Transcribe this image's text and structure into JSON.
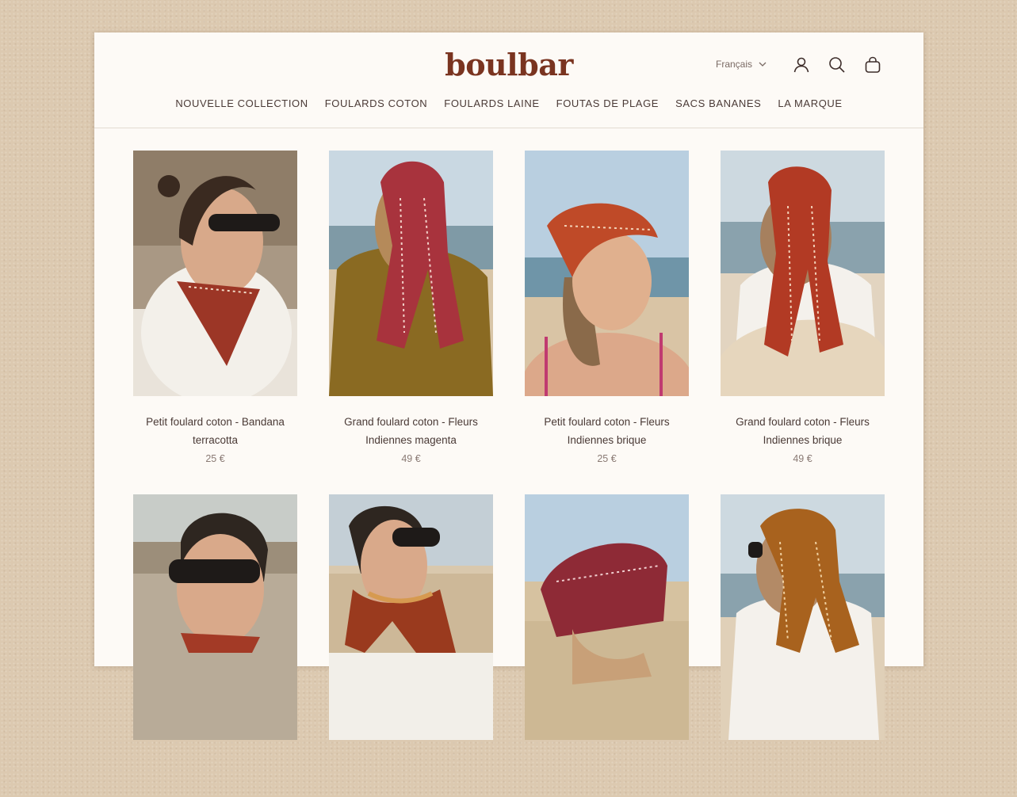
{
  "brand": {
    "logo_text": "boulbar",
    "accent_color": "#7a3420"
  },
  "header": {
    "language": "Français",
    "icons": [
      "account-icon",
      "search-icon",
      "bag-icon"
    ]
  },
  "nav": {
    "items": [
      {
        "label": "NOUVELLE COLLECTION"
      },
      {
        "label": "FOULARDS COTON"
      },
      {
        "label": "FOULARDS LAINE"
      },
      {
        "label": "FOUTAS DE PLAGE"
      },
      {
        "label": "SACS BANANES"
      },
      {
        "label": "LA MARQUE"
      }
    ]
  },
  "products": [
    {
      "title": "Petit foulard coton - Bandana terracotta",
      "price": "25 €",
      "scarf_color": "#9c3626"
    },
    {
      "title": "Grand foulard coton - Fleurs Indiennes magenta",
      "price": "49 €",
      "scarf_color": "#a8333d"
    },
    {
      "title": "Petit foulard coton - Fleurs Indiennes brique",
      "price": "25 €",
      "scarf_color": "#bf4a28"
    },
    {
      "title": "Grand foulard coton - Fleurs Indiennes brique",
      "price": "49 €",
      "scarf_color": "#b23a24"
    },
    {
      "title": "",
      "price": "",
      "scarf_color": "#a33a26"
    },
    {
      "title": "",
      "price": "",
      "scarf_color": "#9a3a1e"
    },
    {
      "title": "",
      "price": "",
      "scarf_color": "#8e2a36"
    },
    {
      "title": "",
      "price": "",
      "scarf_color": "#a8621e"
    }
  ]
}
